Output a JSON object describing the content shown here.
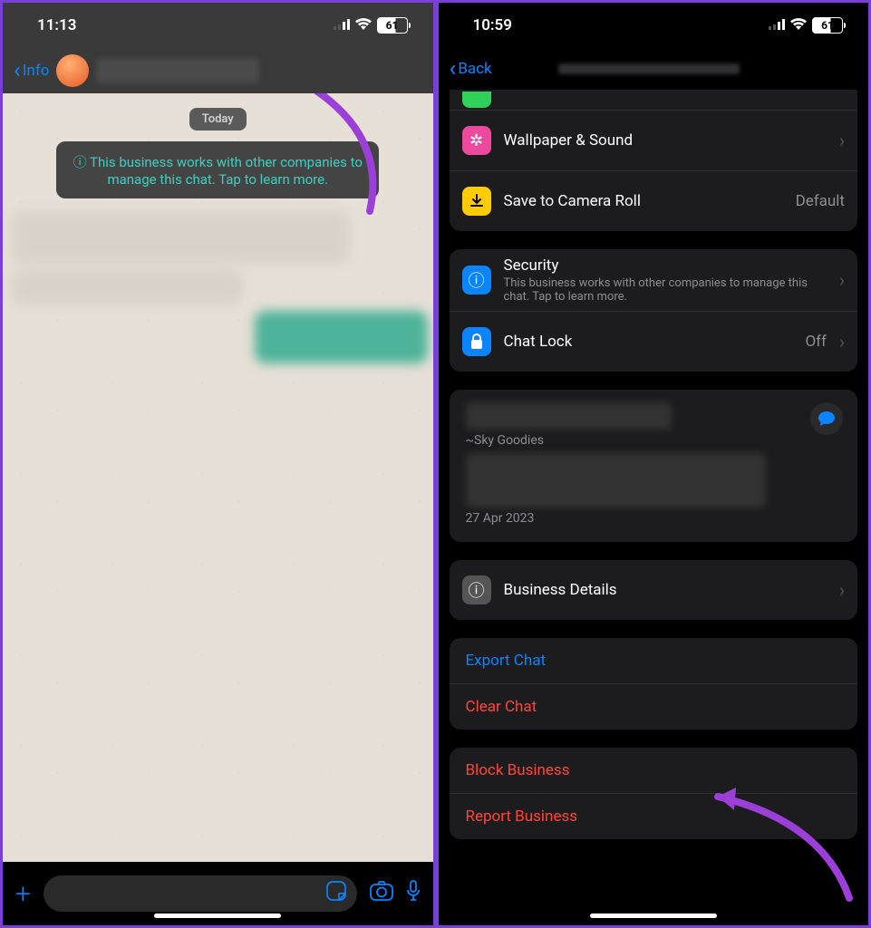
{
  "left": {
    "status": {
      "time": "11:13",
      "battery": "61"
    },
    "back_label": "Info",
    "date_pill": "Today",
    "info_bubble": "This business works with other companies to manage this chat. Tap to learn more."
  },
  "right": {
    "status": {
      "time": "10:59",
      "battery": "61"
    },
    "back_label": "Back",
    "rows": {
      "wallpaper": "Wallpaper & Sound",
      "save": "Save to Camera Roll",
      "save_value": "Default",
      "security_title": "Security",
      "security_sub": "This business works with other companies to manage this chat. Tap to learn more.",
      "chatlock": "Chat Lock",
      "chatlock_value": "Off",
      "sky": "~Sky Goodies",
      "date": "27 Apr 2023",
      "bizdetails": "Business Details",
      "export": "Export Chat",
      "clear": "Clear Chat",
      "block": "Block Business",
      "report": "Report Business"
    }
  }
}
